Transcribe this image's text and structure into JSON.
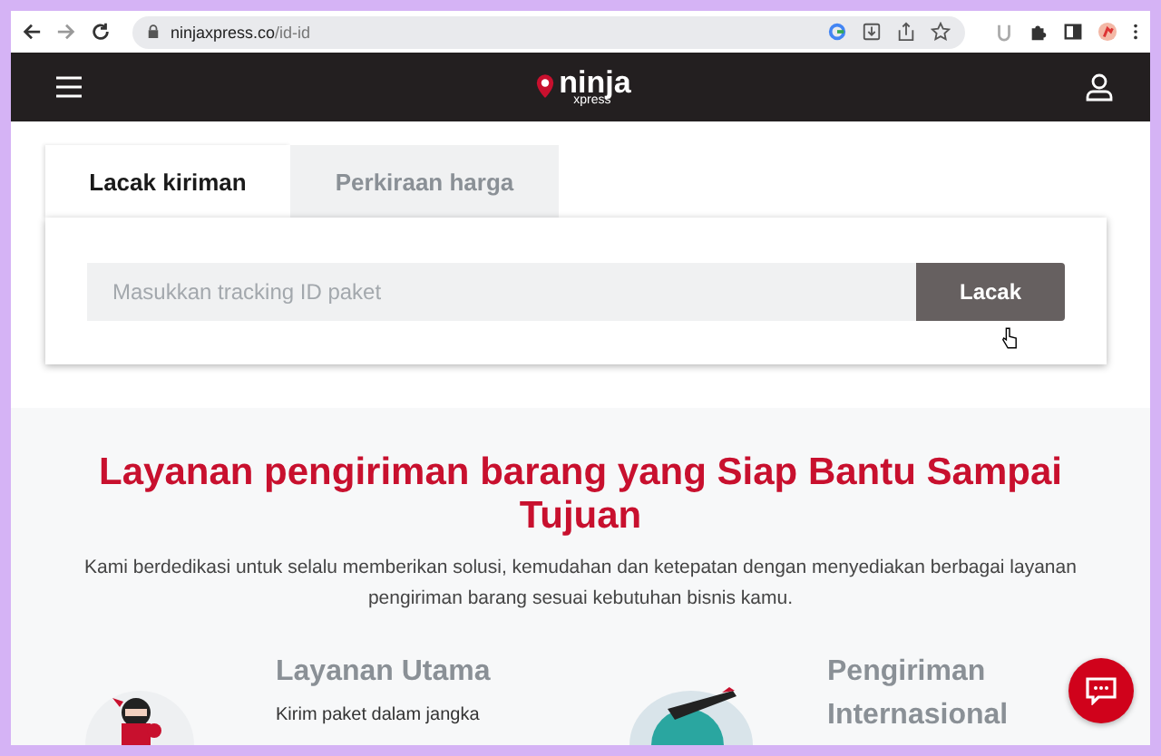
{
  "browser": {
    "url_host": "ninjaxpress.co",
    "url_path": "/id-id"
  },
  "header": {
    "logo_text": "ninja",
    "logo_subtext": "xpress"
  },
  "tracking": {
    "tabs": [
      {
        "label": "Lacak kiriman",
        "selected": true
      },
      {
        "label": "Perkiraan harga",
        "selected": false
      }
    ],
    "search": {
      "placeholder": "Masukkan tracking ID paket"
    },
    "button": "Lacak"
  },
  "intro": {
    "title": "Layanan pengiriman barang yang Siap Bantu Sampai Tujuan",
    "description": "Kami berdedikasi untuk selalu memberikan solusi, kemudahan dan ketepatan dengan menyediakan berbagai layanan pengiriman barang sesuai kebutuhan bisnis kamu."
  },
  "services": [
    {
      "kind": "ninja",
      "title": "Layanan Utama",
      "description": "Kirim paket dalam jangka"
    },
    {
      "kind": "globe",
      "title": "Pengiriman Internasional"
    }
  ]
}
